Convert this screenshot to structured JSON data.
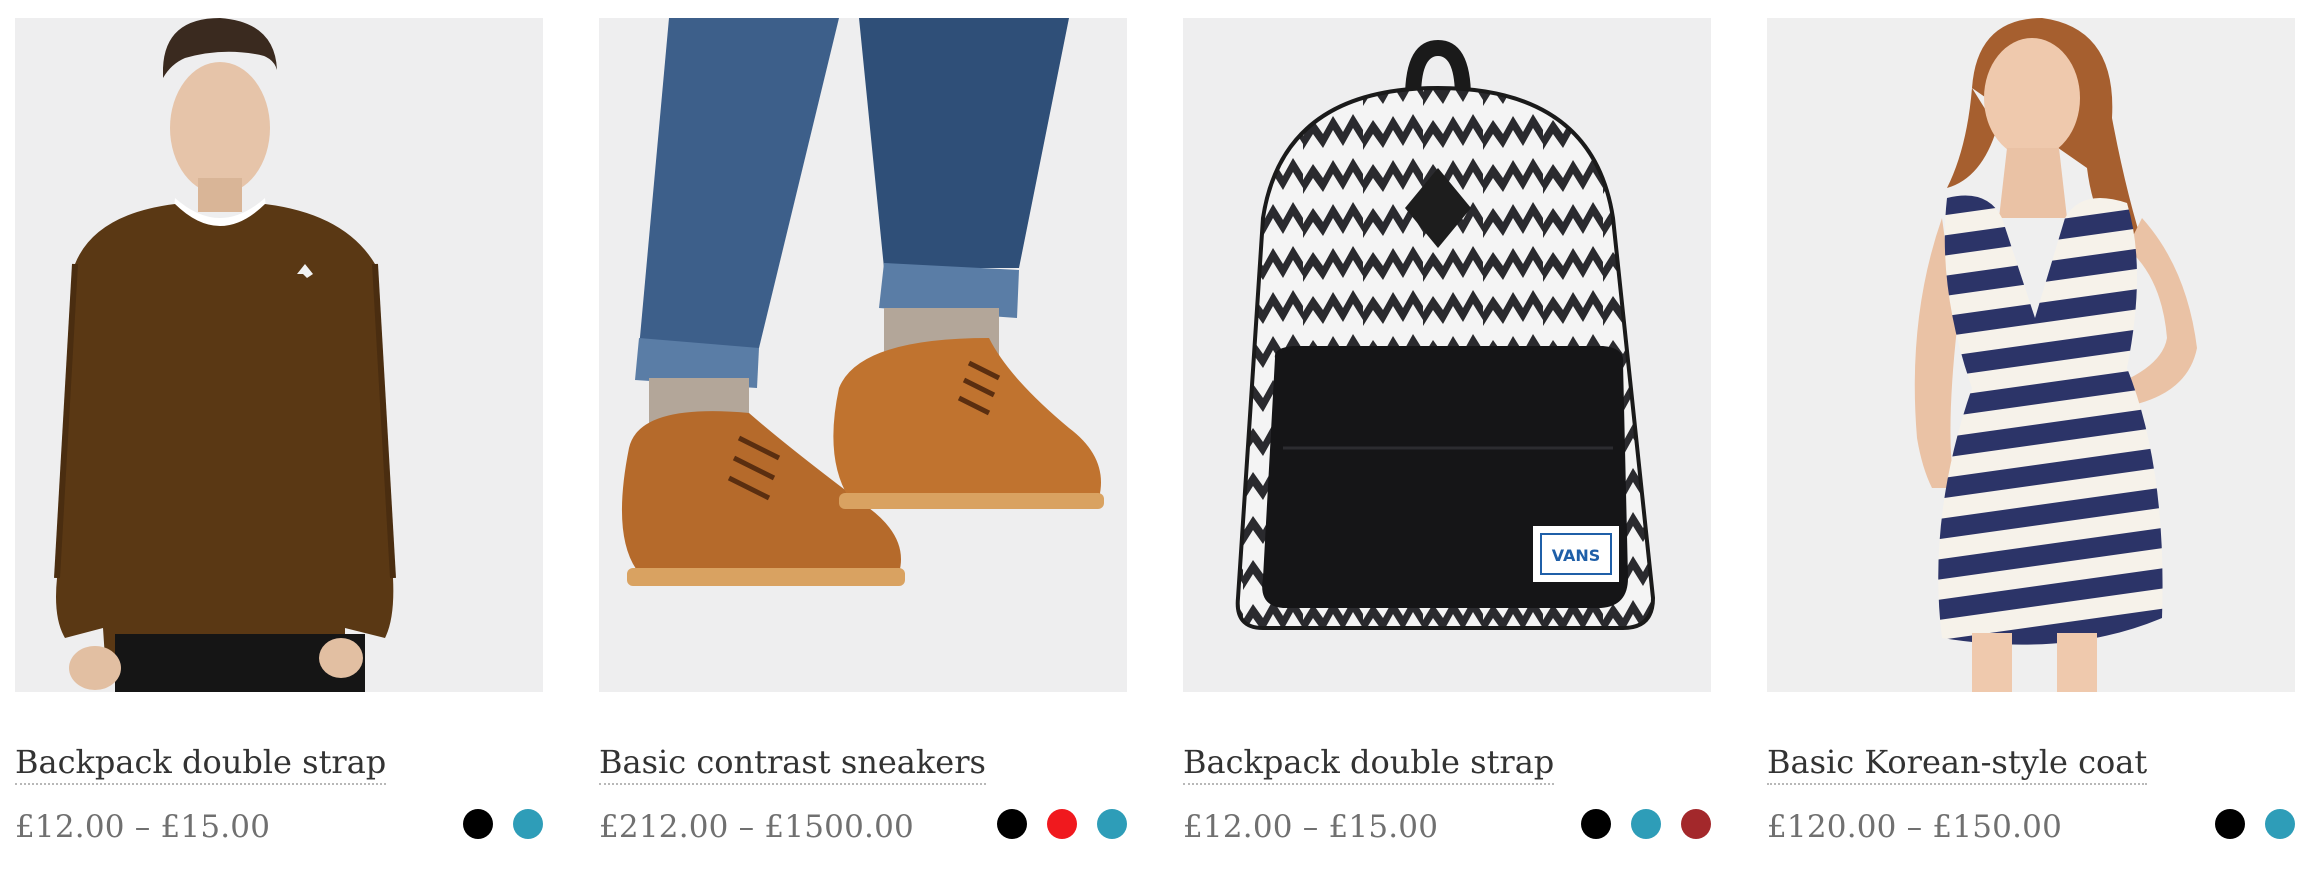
{
  "products": [
    {
      "title": "Backpack double strap",
      "price": "£12.00 – £15.00",
      "swatches": [
        "#000000",
        "#2e9db8"
      ]
    },
    {
      "title": "Basic contrast sneakers",
      "price": "£212.00 – £1500.00",
      "swatches": [
        "#000000",
        "#f0191e",
        "#2e9db8"
      ]
    },
    {
      "title": "Backpack double strap",
      "price": "£12.00 – £15.00",
      "swatches": [
        "#000000",
        "#2e9db8",
        "#a3282b"
      ]
    },
    {
      "title": "Basic Korean-style coat",
      "price": "£120.00 – £150.00",
      "swatches": [
        "#000000",
        "#2e9db8"
      ]
    }
  ],
  "images": {
    "backpack_logo": "VANS"
  }
}
